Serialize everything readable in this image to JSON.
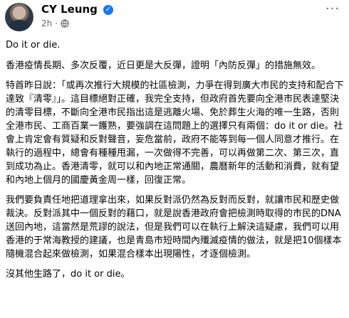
{
  "post": {
    "author": "CY Leung",
    "timestamp": "2h",
    "privacy_icon": "globe-icon",
    "menu_icon": "more-options-icon",
    "verified_icon": "verified-badge-icon"
  },
  "content": {
    "p1": "Do it or die.",
    "p2": "香港疫情長期、多次反覆，近日更是大反彈，證明「內防反彈」的措施無效。",
    "p3": "特首昨日說：「或再次推行大規模的社區檢測，力爭在得到廣大市民的支持和配合下達致『清零』」。這目標絕對正確，我完全支持，但政府首先要向全港市民表達堅決的清零目標，不斷向全港市民指出這是逃離火場、免於葬生火海的唯一生路，否則全港市民、工商百業一鑊熟，要強調在這問題上的選擇只有兩個：do it or die。社會上肯定會有質疑和反對聲音，妄危當前，政府不能等到每一個人同意才推行。在執行的過程中，總會有種種甩漏，一次做得不完善，可以再做第二次、第三次，直到成功為止。香港清零，就可以和內地正常通關，農曆新年的活動和消費，就有望和內地上個月的國慶黃金周一樣，回復正常。",
    "p4": "我們要負責任地把道理拿出來，如果反對派仍然為反對而反對，就讓市民和歷史做裁決。反對派其中一個反對的藉口，就是說香港政府會把檢測時取得的市民的DNA送回內地，這當然是荒謬的說法，但是我們可以在執行上解決這疑慮，我們可以用香港的于常海教授的建議，也是青島市短時間內殲滅疫情的做法，就是把10個樣本隨機混合起來做檢測，如果混合樣本出現陽性，才逐個檢測。",
    "p5": "沒其他生路了，do it or die。"
  }
}
